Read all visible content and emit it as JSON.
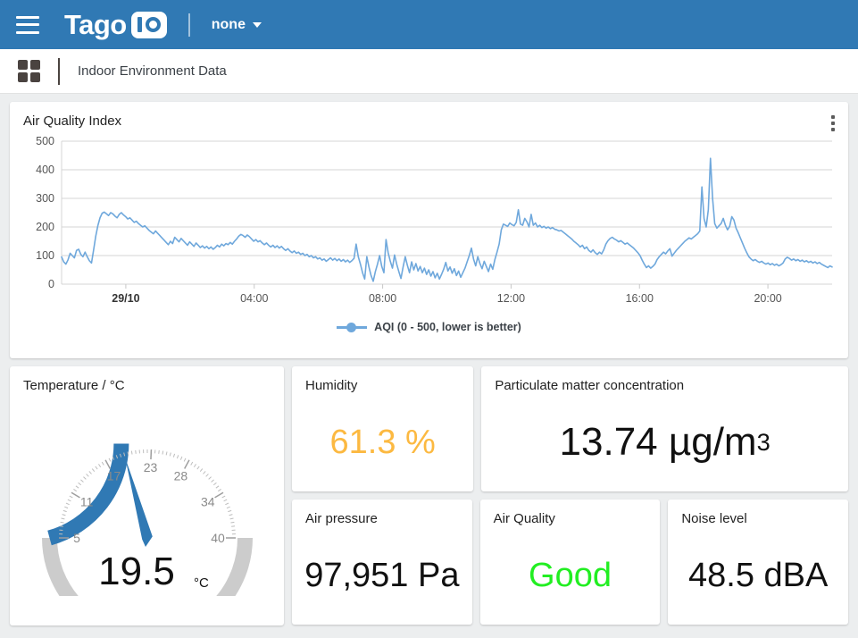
{
  "topbar": {
    "menu_icon": "hamburger-icon",
    "logo_text": "Tago",
    "logo_badge": "IO",
    "context_label": "none",
    "caret_icon": "chevron-down-icon",
    "background": "#3079b4"
  },
  "dashbar": {
    "grid_icon": "grid-icon",
    "title": "Indoor Environment Data"
  },
  "chart_widget": {
    "title": "Air Quality Index",
    "menu_icon": "kebab-menu-icon"
  },
  "chart_data": {
    "type": "line",
    "title": "Air Quality Index",
    "xlabel": "",
    "ylabel": "",
    "ylim": [
      0,
      500
    ],
    "yticks": [
      0,
      100,
      200,
      300,
      400,
      500
    ],
    "xticks": [
      "29/10",
      "04:00",
      "08:00",
      "12:00",
      "16:00",
      "20:00"
    ],
    "xtick_bold": [
      "29/10"
    ],
    "grid": true,
    "legend_position": "bottom",
    "line_color": "#6fa8dc",
    "series": [
      {
        "name": "AQI (0 - 500, lower is better)",
        "values": [
          95,
          78,
          70,
          85,
          108,
          100,
          92,
          118,
          122,
          104,
          96,
          112,
          96,
          82,
          74,
          120,
          168,
          205,
          232,
          248,
          252,
          246,
          240,
          250,
          246,
          238,
          232,
          244,
          250,
          242,
          236,
          228,
          232,
          224,
          216,
          220,
          212,
          206,
          200,
          204,
          196,
          188,
          182,
          176,
          186,
          178,
          170,
          162,
          154,
          146,
          138,
          150,
          142,
          164,
          156,
          148,
          160,
          152,
          144,
          136,
          148,
          140,
          132,
          144,
          136,
          128,
          134,
          126,
          132,
          124,
          130,
          122,
          128,
          136,
          130,
          140,
          134,
          142,
          138,
          146,
          140,
          150,
          158,
          168,
          174,
          170,
          164,
          172,
          166,
          158,
          150,
          156,
          148,
          152,
          144,
          138,
          144,
          136,
          130,
          136,
          128,
          134,
          126,
          132,
          124,
          118,
          124,
          116,
          110,
          116,
          108,
          112,
          104,
          108,
          100,
          104,
          96,
          100,
          92,
          96,
          88,
          92,
          84,
          88,
          80,
          86,
          92,
          84,
          90,
          82,
          88,
          80,
          86,
          78,
          84,
          76,
          82,
          90,
          140,
          96,
          70,
          40,
          18,
          96,
          60,
          30,
          10,
          44,
          70,
          100,
          62,
          40,
          156,
          110,
          80,
          56,
          102,
          70,
          44,
          20,
          60,
          96,
          66,
          40,
          78,
          50,
          72,
          46,
          62,
          40,
          56,
          34,
          50,
          28,
          44,
          22,
          38,
          18,
          34,
          52,
          76,
          46,
          60,
          38,
          54,
          30,
          46,
          24,
          40,
          56,
          78,
          100,
          126,
          88,
          64,
          96,
          72,
          54,
          80,
          62,
          44,
          70,
          52,
          86,
          112,
          140,
          190,
          210,
          206,
          202,
          214,
          208,
          204,
          216,
          260,
          210,
          206,
          230,
          218,
          200,
          244,
          206,
          214,
          200,
          206,
          198,
          202,
          196,
          200,
          194,
          198,
          192,
          190,
          186,
          188,
          182,
          176,
          170,
          164,
          158,
          150,
          144,
          138,
          130,
          136,
          124,
          130,
          118,
          112,
          120,
          110,
          104,
          112,
          106,
          120,
          140,
          152,
          160,
          164,
          158,
          154,
          148,
          152,
          146,
          140,
          144,
          138,
          132,
          126,
          118,
          110,
          100,
          84,
          70,
          58,
          64,
          56,
          62,
          70,
          86,
          96,
          104,
          112,
          106,
          116,
          124,
          98,
          108,
          118,
          126,
          134,
          142,
          150,
          156,
          162,
          158,
          164,
          170,
          176,
          186,
          340,
          230,
          200,
          260,
          440,
          300,
          212,
          196,
          204,
          212,
          230,
          206,
          190,
          202,
          236,
          224,
          196,
          180,
          162,
          144,
          126,
          110,
          96,
          88,
          82,
          86,
          80,
          76,
          80,
          74,
          70,
          74,
          68,
          72,
          66,
          70,
          64,
          68,
          74,
          88,
          94,
          90,
          84,
          88,
          82,
          86,
          80,
          84,
          78,
          82,
          76,
          80,
          74,
          78,
          72,
          76,
          70,
          66,
          62,
          58,
          64,
          60
        ]
      }
    ],
    "legend": [
      "AQI (0 - 500, lower is better)"
    ]
  },
  "temperature_widget": {
    "title": "Temperature / °C",
    "value": "19.5",
    "unit": "°C",
    "gauge": {
      "min": 5,
      "max": 40,
      "value": 19.5,
      "tick_labels": [
        "5",
        "11",
        "17",
        "23",
        "28",
        "34",
        "40"
      ],
      "fill_color": "#3079b4",
      "track_color": "#cccccc"
    }
  },
  "metrics": [
    {
      "title": "Humidity",
      "value": "61.3 %",
      "color": "#fcb941"
    },
    {
      "title": "Particulate matter concentration",
      "value": "13.74 µg/m",
      "sup": "3",
      "color": "#111111"
    },
    {
      "title": "Air pressure",
      "value": "97,951 Pa",
      "color": "#111111"
    },
    {
      "title": "Air Quality",
      "value": "Good",
      "color": "#22ee22"
    },
    {
      "title": "Noise level",
      "value": "48.5 dBA",
      "color": "#111111"
    }
  ]
}
